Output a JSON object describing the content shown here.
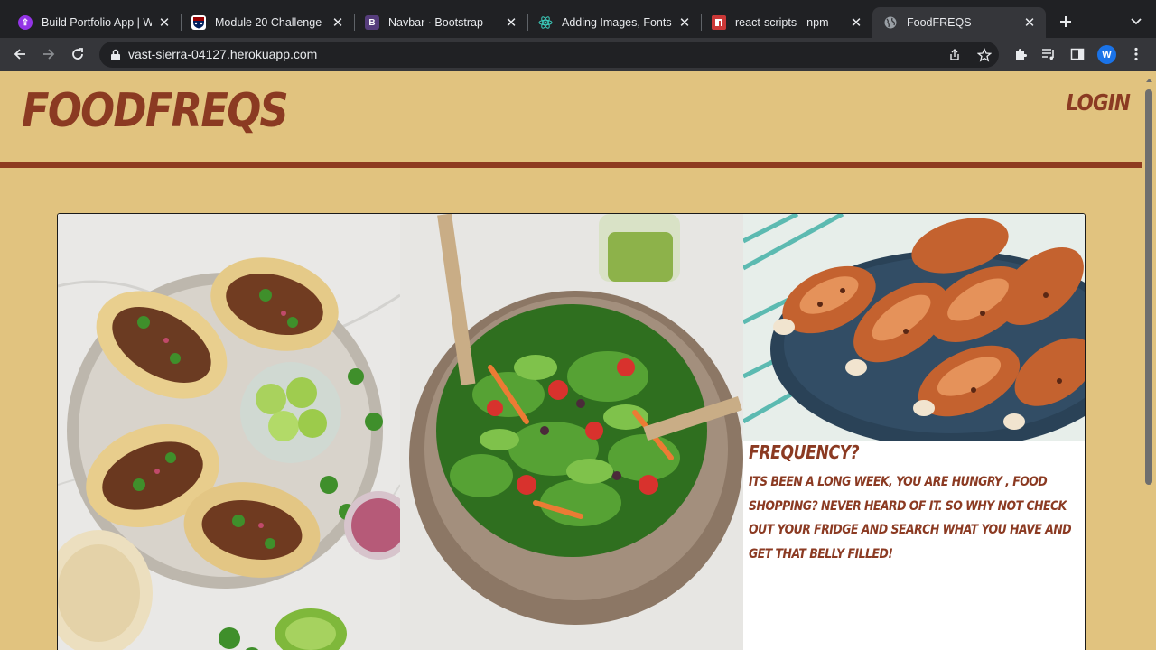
{
  "browser": {
    "tabs": [
      {
        "title": "Build Portfolio App | W",
        "icon": "purple-app-icon"
      },
      {
        "title": "Module 20 Challenge",
        "icon": "university-shield-icon"
      },
      {
        "title": "Navbar · Bootstrap",
        "icon": "bootstrap-icon"
      },
      {
        "title": "Adding Images, Fonts,",
        "icon": "react-icon"
      },
      {
        "title": "react-scripts - npm",
        "icon": "npm-icon"
      },
      {
        "title": "FoodFREQS",
        "icon": "globe-icon",
        "active": true
      }
    ],
    "url": "vast-sierra-04127.herokuapp.com",
    "profile_initial": "W"
  },
  "site": {
    "brand": "FOODFREQS",
    "login_label": "LOGIN",
    "colors": {
      "background": "#e1c37f",
      "accent": "#8b3a22"
    }
  },
  "cards": [
    {
      "image": "tacos-photo"
    },
    {
      "image": "salad-bowl-photo"
    },
    {
      "image": "grilled-chicken-drumsticks-photo",
      "title": "FREQUENCY?",
      "text": "ITS BEEN A LONG WEEK, YOU ARE HUNGRY , FOOD SHOPPING? NEVER HEARD OF IT. SO WHY NOT CHECK OUT YOUR FRIDGE AND SEARCH WHAT YOU HAVE AND GET THAT BELLY FILLED!"
    }
  ]
}
